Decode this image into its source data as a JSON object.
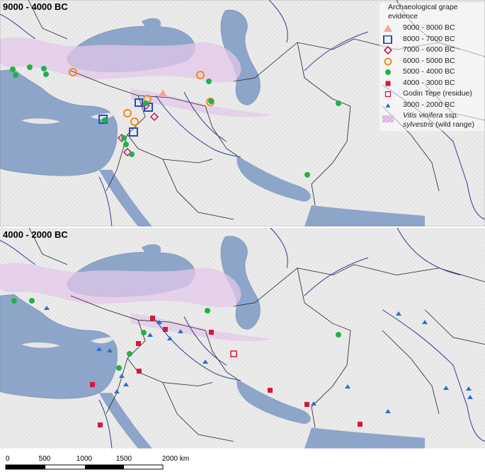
{
  "maps": [
    {
      "title": "9000 - 4000 BC"
    },
    {
      "title": "4000 - 2000 BC"
    }
  ],
  "legend": {
    "title": "Archaeological grape evidence",
    "items": [
      {
        "label": "9000 - 8000 BC",
        "symbol": "triangle",
        "color": "#f2a7a0"
      },
      {
        "label": "8000 - 7000 BC",
        "symbol": "square-outline",
        "color": "#1f4fbf"
      },
      {
        "label": "7000 - 6000 BC",
        "symbol": "diamond-outline",
        "color": "#c0185a"
      },
      {
        "label": "6000 - 5000 BC",
        "symbol": "circle-outline",
        "color": "#f08a1c"
      },
      {
        "label": "5000 - 4000 BC",
        "symbol": "circle",
        "color": "#22b04b"
      },
      {
        "label": "4000 - 3000 BC",
        "symbol": "square",
        "color": "#d4183c"
      },
      {
        "label": "Godin Tepe (residue)",
        "symbol": "square-outline-small",
        "color": "#d4183c"
      },
      {
        "label": "3000 - 2000 BC",
        "symbol": "small-triangle",
        "color": "#2a6fd6"
      }
    ],
    "wild_range": {
      "label_italic": "Vitis vinifera",
      "label_rest": "ssp.",
      "label_italic2": "sylvestris",
      "label_end": "(wild range)",
      "color": "#e3c8e8"
    }
  },
  "scale_bar": {
    "ticks": [
      "0",
      "500",
      "1000",
      "1500",
      "2000 km"
    ]
  },
  "colors": {
    "sea": "#8da5c9",
    "land": "#eeeeee",
    "river": "#2c3f8f",
    "border": "#222222"
  }
}
